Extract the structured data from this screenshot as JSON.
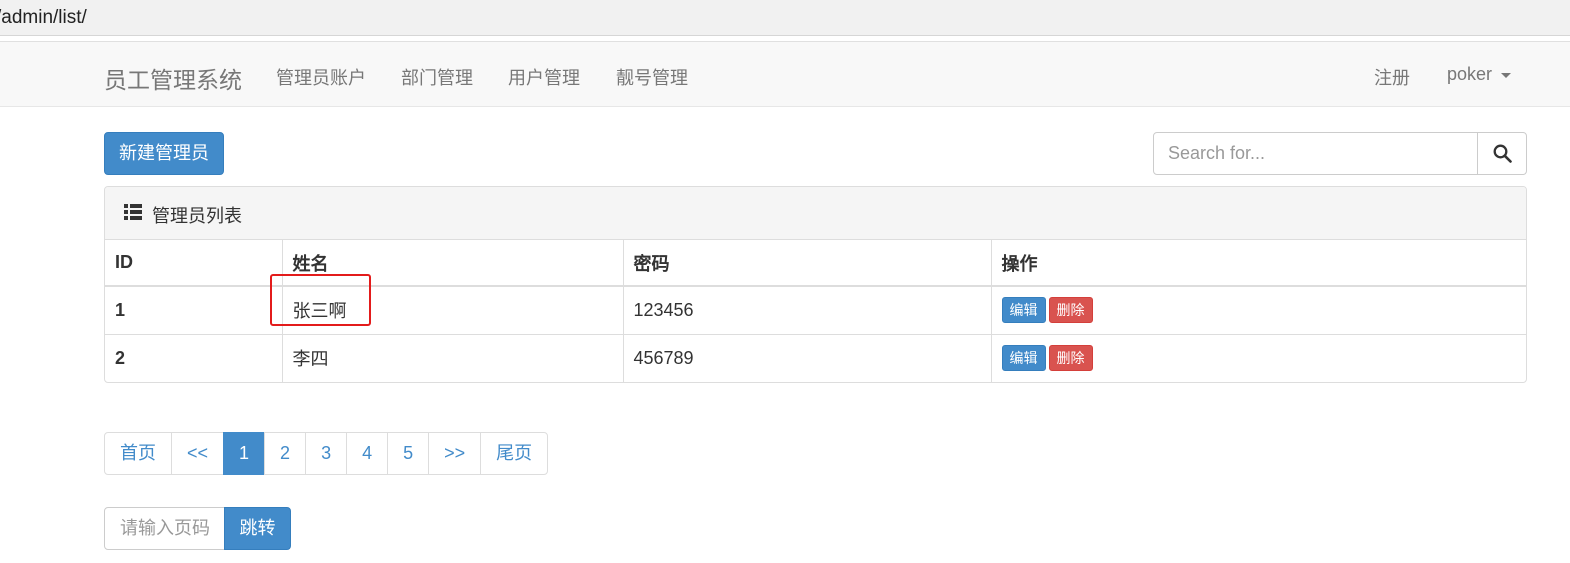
{
  "browser": {
    "url": "/admin/list/"
  },
  "navbar": {
    "brand": "员工管理系统",
    "links": [
      "管理员账户",
      "部门管理",
      "用户管理",
      "靓号管理"
    ],
    "register": "注册",
    "user": "poker"
  },
  "toolbar": {
    "new_admin": "新建管理员",
    "search_placeholder": "Search for...",
    "search_icon": "search-icon"
  },
  "panel": {
    "icon": "list-icon",
    "title": "管理员列表",
    "columns": [
      "ID",
      "姓名",
      "密码",
      "操作"
    ],
    "rows": [
      {
        "id": "1",
        "name": "张三啊",
        "password": "123456",
        "edit": "编辑",
        "delete": "删除"
      },
      {
        "id": "2",
        "name": "李四",
        "password": "456789",
        "edit": "编辑",
        "delete": "删除"
      }
    ]
  },
  "pagination": {
    "items": [
      "首页",
      "<<",
      "1",
      "2",
      "3",
      "4",
      "5",
      ">>",
      "尾页"
    ],
    "active": "1"
  },
  "jump": {
    "placeholder": "请输入页码",
    "button": "跳转"
  },
  "colors": {
    "primary": "#428bca",
    "danger": "#d9534f",
    "highlight": "#e31b1b"
  }
}
